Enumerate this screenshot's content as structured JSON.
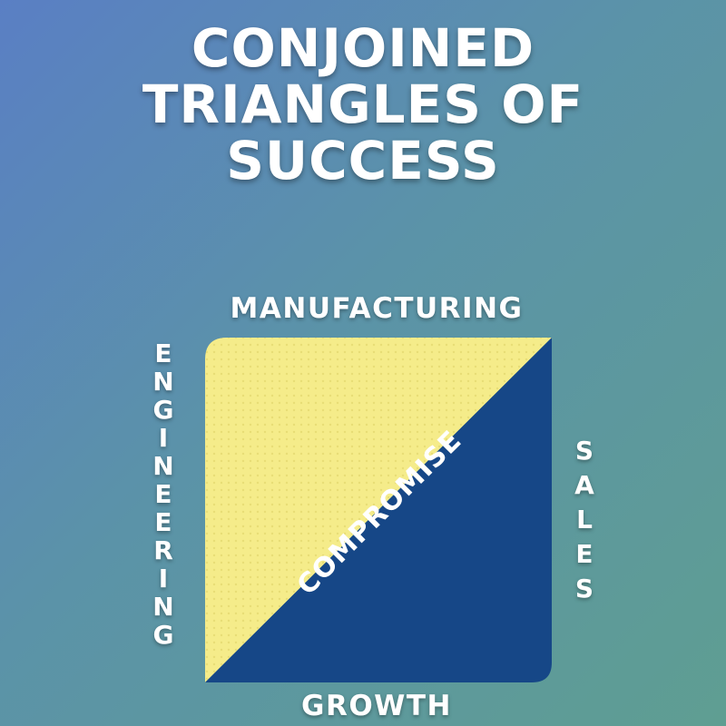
{
  "title_lines": [
    "CONJOINED",
    "TRIANGLES OF",
    "SUCCESS"
  ],
  "labels": {
    "top": "MANUFACTURING",
    "left": "ENGINEERING",
    "right": "SALES",
    "bottom": "GROWTH",
    "diagonal": "COMPROMISE"
  },
  "colors": {
    "upper_triangle": "#f5ec8a",
    "lower_triangle": "#164787",
    "text": "#ffffff"
  }
}
